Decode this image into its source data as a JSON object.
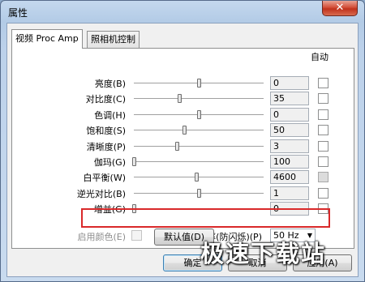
{
  "window": {
    "title": "属性",
    "close_glyph": "✕"
  },
  "tabs": [
    {
      "label": "视频 Proc Amp",
      "active": true
    },
    {
      "label": "照相机控制",
      "active": false
    }
  ],
  "auto_header": "自动",
  "rows": [
    {
      "label": "亮度(B)",
      "value": "0",
      "position": 0.5,
      "auto": "unchecked"
    },
    {
      "label": "对比度(C)",
      "value": "35",
      "position": 0.35,
      "auto": "unchecked"
    },
    {
      "label": "色调(H)",
      "value": "0",
      "position": 0.5,
      "auto": "unchecked"
    },
    {
      "label": "饱和度(S)",
      "value": "50",
      "position": 0.39,
      "auto": "unchecked"
    },
    {
      "label": "清晰度(P)",
      "value": "3",
      "position": 0.33,
      "auto": "unchecked"
    },
    {
      "label": "伽玛(G)",
      "value": "100",
      "position": 0.0,
      "auto": "unchecked"
    },
    {
      "label": "白平衡(W)",
      "value": "4600",
      "position": 0.48,
      "auto": "greyed"
    },
    {
      "label": "逆光对比(B)",
      "value": "1",
      "position": 0.5,
      "auto": "unchecked"
    },
    {
      "label": "增益(G)",
      "value": "0",
      "position": 0.0,
      "auto": "unchecked",
      "highlighted": true
    }
  ],
  "enable_color": {
    "label": "启用颜色(E)",
    "enabled": false
  },
  "powerline": {
    "label": "电力线频率(防闪烁)(P)",
    "selected": "50 Hz"
  },
  "buttons": {
    "defaults": "默认值(D)",
    "ok": "确定",
    "cancel": "取消",
    "apply": "应用(A)"
  },
  "watermark": "极速下载站",
  "colors": {
    "highlight": "#d9292a",
    "close": "#c0321c"
  }
}
